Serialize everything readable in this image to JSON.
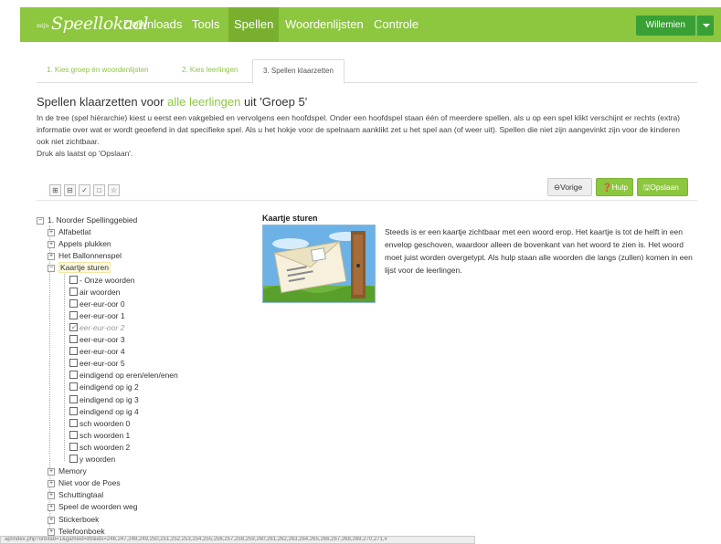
{
  "brand": {
    "small": "mijn",
    "big": "Speellokaal"
  },
  "nav": {
    "items": [
      {
        "label": "Downloads"
      },
      {
        "label": "Tools"
      },
      {
        "label": "Spellen"
      },
      {
        "label": "Woordenlijsten"
      },
      {
        "label": "Controle"
      }
    ],
    "active": "Spellen",
    "user": "Willemien"
  },
  "tabs": [
    {
      "label": "1. Kies groep én woordenlijsten"
    },
    {
      "label": "2. Kies leerlingen"
    },
    {
      "label": "3. Spellen klaarzetten"
    }
  ],
  "heading": {
    "prefix": "Spellen klaarzetten voor ",
    "highlight": "alle leerlingen",
    "suffix": " uit 'Groep 5'"
  },
  "intro": [
    "In de tree (spel hiërarchie) kiest u eerst een vakgebied en vervolgens een hoofdspel. Onder een hoofdspel staan één of meerdere spellen. als u op een spel klikt verschijnt er rechts (extra) informatie over  wat er wordt geoefend in dat specifieke spel. Als u het hokje voor de spelnaam aanklikt zet u het spel aan (of weer uit). Spellen die niet zijn aangevinkt zijn voor de kinderen ook niet zichtbaar.",
    "Druk als laatst op 'Opslaan'."
  ],
  "toolbar": {
    "icons": [
      "expand-all-icon",
      "collapse-all-icon",
      "check-all-icon",
      "uncheck-all-icon",
      "star-icon"
    ],
    "vorige": "Vorige",
    "hulp": "Hulp",
    "opslaan": "Opslaan"
  },
  "tree": {
    "root": "1. Noorder Spellinggebied",
    "groups_before": [
      "Alfabetlat",
      "Appels plukken",
      "Het Ballonnenspel"
    ],
    "selected_group": "Kaartje sturen",
    "games": [
      {
        "label": "- Onze woorden",
        "checked": false,
        "disabled": false
      },
      {
        "label": "air woorden",
        "checked": false,
        "disabled": false
      },
      {
        "label": "eer-eur-oor 0",
        "checked": false,
        "disabled": false
      },
      {
        "label": "eer-eur-oor 1",
        "checked": false,
        "disabled": false
      },
      {
        "label": "eer-eur-oor 2",
        "checked": true,
        "disabled": true
      },
      {
        "label": "eer-eur-oor 3",
        "checked": false,
        "disabled": false
      },
      {
        "label": "eer-eur-oor 4",
        "checked": false,
        "disabled": false
      },
      {
        "label": "eer-eur-oor 5",
        "checked": false,
        "disabled": false
      },
      {
        "label": "eindigend op eren/elen/enen",
        "checked": false,
        "disabled": false
      },
      {
        "label": "eindigend op ig 2",
        "checked": false,
        "disabled": false
      },
      {
        "label": "eindigend op ig 3",
        "checked": false,
        "disabled": false
      },
      {
        "label": "eindigend op ig 4",
        "checked": false,
        "disabled": false
      },
      {
        "label": "sch woorden 0",
        "checked": false,
        "disabled": false
      },
      {
        "label": "sch woorden 1",
        "checked": false,
        "disabled": false
      },
      {
        "label": "sch woorden 2",
        "checked": false,
        "disabled": false
      },
      {
        "label": "y woorden",
        "checked": false,
        "disabled": false
      }
    ],
    "groups_after": [
      "Memory",
      "Niet voor de Poes",
      "Schuttingtaal",
      "Speel de woorden weg",
      "Stickerboek",
      "Telefoonboek"
    ]
  },
  "detail": {
    "title": "Kaartje sturen",
    "text": "Steeds is er een kaartje zichtbaar met een woord erop. Het kaartje is tot de helft in een envelop geschoven, waardoor alleen de bovenkant van het woord te zien is. Het woord moet juist worden overgetypt. Als hulp staan alle woorden die langs (zullen) komen in een lijst voor de leerlingen."
  },
  "status_url": "ap/index.php?orbitab=1&gameid=89&ids=246,247,248,249,250,251,252,253,254,255,256,257,258,259,260,261,262,263,264,265,266,267,268,269,270,271,#",
  "colors": {
    "brand_green": "#8dc63f",
    "active_nav": "#78b02e",
    "user_button": "#39a036"
  }
}
